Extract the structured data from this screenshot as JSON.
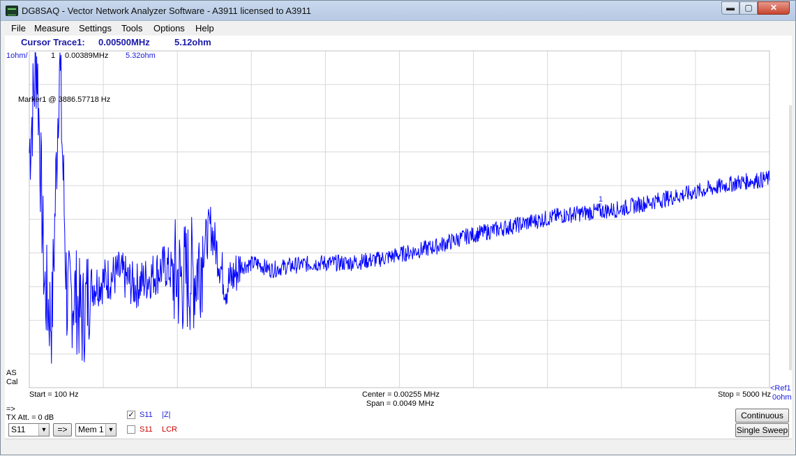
{
  "window": {
    "title": "DG8SAQ  -  Vector Network Analyzer Software  - A3911 licensed to A3911"
  },
  "title_buttons": {
    "minimize": "▬",
    "maximize": "▢",
    "close": "✕"
  },
  "menu": [
    "File",
    "Measure",
    "Settings",
    "Tools",
    "Options",
    "Help"
  ],
  "cursor": {
    "label": "Cursor Trace1:",
    "freq": "0.00500MHz",
    "value": "5.12ohm"
  },
  "plot_header": {
    "scale": "1ohm/",
    "marker_num": "1",
    "marker_freq": "0.00389MHz",
    "marker_value": "5.32ohm"
  },
  "marker_note": "Marker1 @ 3886.57718 Hz",
  "marker_symbol": "1",
  "left_labels": {
    "as": "AS",
    "cal": "Cal"
  },
  "axis": {
    "start": "Start = 100 Hz",
    "center": "Center = 0.00255 MHz",
    "span": "Span = 0.0049 MHz",
    "stop": "Stop = 5000 Hz",
    "ref": "<Ref1",
    "ref_val": "0ohm"
  },
  "tx": {
    "arrow": "=>",
    "att": "TX Att.  = 0 dB"
  },
  "controls": {
    "param_select": "S11",
    "copy_button": "=>",
    "mem_select": "Mem 1",
    "trace1_name": "S11",
    "trace1_fmt": "|Z|",
    "trace2_name": "S11",
    "trace2_fmt": "LCR",
    "continuous": "Continuous",
    "single_sweep": "Single Sweep"
  },
  "colors": {
    "trace": "#0000ff",
    "trace2_label": "#cc0000",
    "grid": "#d8d8d8"
  },
  "chart_data": {
    "type": "line",
    "xlabel": "",
    "ylabel": "",
    "xlim": [
      100,
      5000
    ],
    "ylim": [
      0,
      10
    ],
    "series": [
      {
        "name": "S11 |Z|",
        "x": [
          100,
          150,
          200,
          250,
          300,
          350,
          400,
          450,
          500,
          600,
          700,
          800,
          900,
          1000,
          1100,
          1200,
          1300,
          1400,
          1500,
          1600,
          1700,
          1800,
          2000,
          2200,
          2400,
          2600,
          2800,
          3000,
          3200,
          3400,
          3600,
          3800,
          4000,
          4200,
          4400,
          4600,
          4800,
          5000
        ],
        "y": [
          7.0,
          9.9,
          3.0,
          2.0,
          9.9,
          2.5,
          2.8,
          2.0,
          3.0,
          3.2,
          3.4,
          3.0,
          3.3,
          3.6,
          3.2,
          3.4,
          4.8,
          3.0,
          3.6,
          3.7,
          3.5,
          3.6,
          3.7,
          3.7,
          3.8,
          4.0,
          4.2,
          4.5,
          4.7,
          4.9,
          5.1,
          5.2,
          5.3,
          5.5,
          5.7,
          5.9,
          6.1,
          6.2
        ]
      }
    ]
  }
}
